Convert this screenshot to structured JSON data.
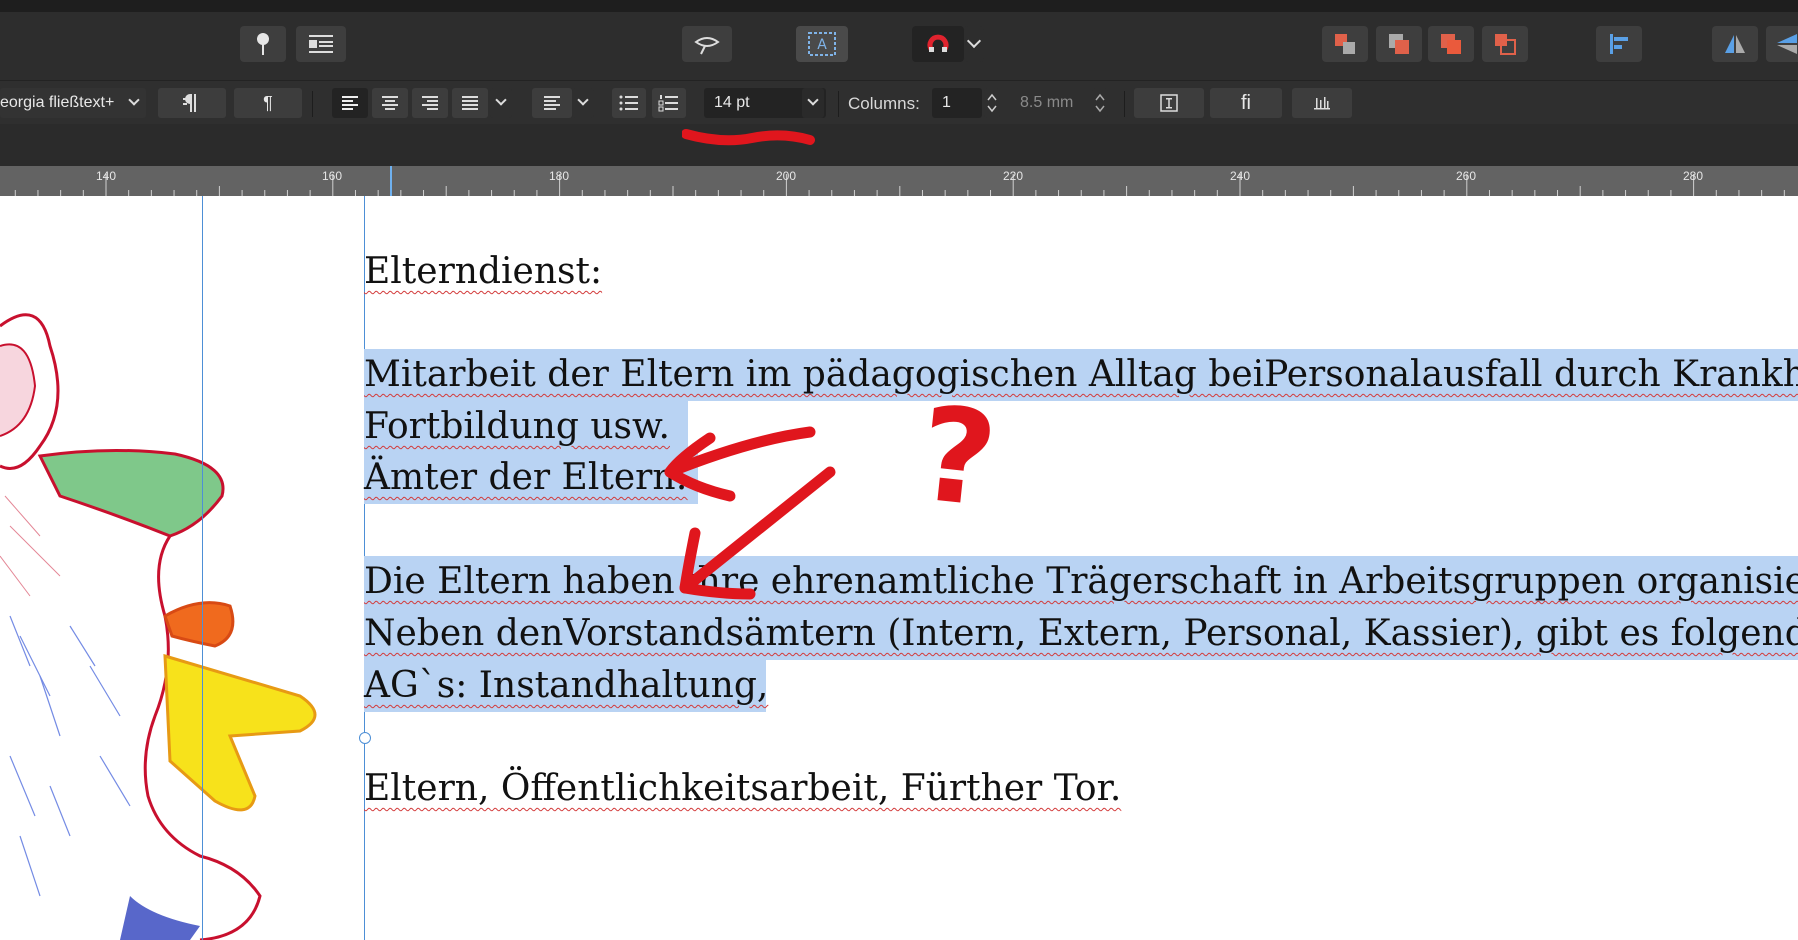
{
  "context_toolbar": {
    "font_style": "eorgia fließtext+",
    "paragraph_icon": "¶",
    "font_size": "14 pt",
    "columns_label": "Columns:",
    "columns_value": "1",
    "gutter_value": "8.5 mm",
    "ligature_label": "fi"
  },
  "ruler": {
    "ticks": [
      "140",
      "160",
      "180",
      "200",
      "220",
      "240",
      "260",
      "280"
    ]
  },
  "document": {
    "lines": [
      "Elterndienst:",
      "Mitarbeit der Eltern im pädagogischen Alltag beiPersonalausfall durch Krankheit",
      "Fortbildung usw.",
      "Ämter der Eltern:",
      "Die Eltern haben ihre ehrenamtliche Trägerschaft in Arbeitsgruppen organisiert.",
      "Neben denVorstandsämtern (Intern, Extern, Personal, Kassier), gibt es folgende",
      "AG`s: Instandhaltung,",
      "Eltern, Öffentlichkeitsarbeit, Fürther Tor."
    ]
  },
  "annotation": {
    "question_mark": "?",
    "color": "#e0161d"
  },
  "colors": {
    "selection": "#b9d3f3",
    "guide": "#4d8fd6",
    "toolbar_bg": "#2d2d2d",
    "accent_red": "#e0614a"
  }
}
